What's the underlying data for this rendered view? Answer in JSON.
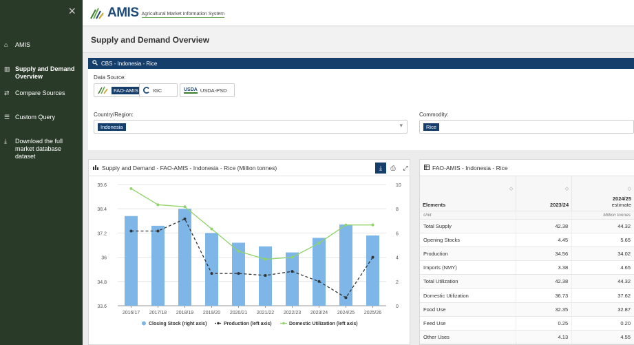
{
  "sidebar": {
    "close_icon": "×",
    "items": [
      {
        "label": "AMIS",
        "icon": "home-icon"
      },
      {
        "label": "Supply and Demand Overview",
        "icon": "bar-chart-icon"
      },
      {
        "label": "Compare Sources",
        "icon": "compare-icon"
      },
      {
        "label": "Custom Query",
        "icon": "query-icon"
      },
      {
        "label": "Download the full market database dataset",
        "icon": "download-icon"
      }
    ]
  },
  "header": {
    "brand": "AMIS",
    "brand_sub": "Agricultural Market Information System"
  },
  "page": {
    "title": "Supply and Demand Overview"
  },
  "query": {
    "panel_title": "CBS - Indonesia - Rice",
    "data_source_label": "Data Source:",
    "sources": [
      {
        "label": "FAO-AMIS",
        "selected": true
      },
      {
        "label": "IGC",
        "selected": false
      },
      {
        "label": "USDA-PSD",
        "selected": false
      }
    ],
    "usda_logo_text": "USDA",
    "country_label": "Country/Region:",
    "country_value": "Indonesia",
    "commodity_label": "Commodity:",
    "commodity_value": "Rice"
  },
  "chart_panel": {
    "title": "Supply and Demand - FAO-AMIS - Indonesia - Rice (Million tonnes)"
  },
  "chart_data": {
    "type": "bar",
    "categories": [
      "2016/17",
      "2017/18",
      "2018/19",
      "2019/20",
      "2020/21",
      "2021/22",
      "2022/23",
      "2023/24",
      "2024/25",
      "2025/26"
    ],
    "series": [
      {
        "name": "Closing Stock (right axis)",
        "type": "bar",
        "axis": "right",
        "color": "#7eb6e8",
        "values": [
          7.4,
          6.6,
          8.0,
          6.0,
          5.2,
          4.9,
          4.4,
          5.6,
          6.7,
          5.8
        ]
      },
      {
        "name": "Production (left axis)",
        "type": "line",
        "axis": "left",
        "color": "#333333",
        "dashed": true,
        "values": [
          37.3,
          37.3,
          37.9,
          35.2,
          35.2,
          35.1,
          35.3,
          34.8,
          34.0,
          36.0
        ]
      },
      {
        "name": "Domestic Utilization (left axis)",
        "type": "line",
        "axis": "left",
        "color": "#8fd36a",
        "values": [
          39.4,
          38.6,
          38.5,
          37.4,
          36.3,
          35.9,
          36.0,
          36.7,
          37.6,
          37.6
        ]
      }
    ],
    "y_left": {
      "min": 33.6,
      "max": 39.6,
      "ticks": [
        "33.6",
        "34.8",
        "36",
        "37.2",
        "38.4",
        "39.6"
      ]
    },
    "y_right": {
      "min": 0,
      "max": 10,
      "ticks": [
        "0",
        "2",
        "4",
        "6",
        "8",
        "10"
      ]
    },
    "legend_position": "bottom",
    "grid": true
  },
  "table_panel": {
    "title": "FAO-AMIS - Indonesia - Rice",
    "col_elements": "Elements",
    "col_2023": "2023/24",
    "col_2024_line1": "2024/25",
    "col_2024_line2": "estimate",
    "unit_label": "Unit",
    "unit_value": "Million tonnes",
    "rows": [
      {
        "element": "Total Supply",
        "v2023": "42.38",
        "v2024": "44.32"
      },
      {
        "element": "Opening Stocks",
        "v2023": "4.45",
        "v2024": "5.65"
      },
      {
        "element": "Production",
        "v2023": "34.56",
        "v2024": "34.02"
      },
      {
        "element": "Imports (NMY)",
        "v2023": "3.38",
        "v2024": "4.65"
      },
      {
        "element": "Total Utilization",
        "v2023": "42.38",
        "v2024": "44.32"
      },
      {
        "element": "Domestic Utilization",
        "v2023": "36.73",
        "v2024": "37.62"
      },
      {
        "element": "Food Use",
        "v2023": "32.35",
        "v2024": "32.87"
      },
      {
        "element": "Feed Use",
        "v2023": "0.25",
        "v2024": "0.20"
      },
      {
        "element": "Other Uses",
        "v2023": "4.13",
        "v2024": "4.55"
      }
    ]
  }
}
